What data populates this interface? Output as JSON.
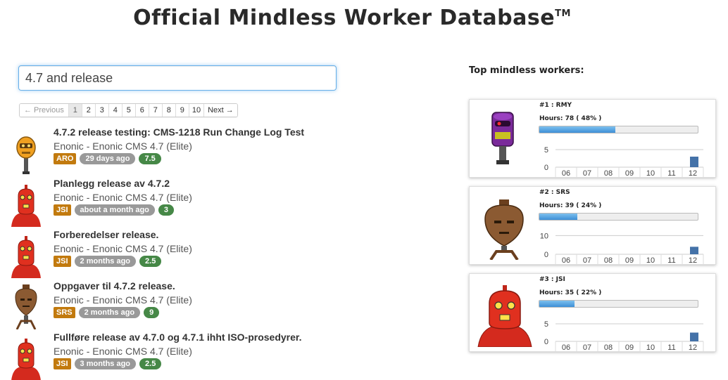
{
  "page": {
    "title": "Official Mindless Worker Database",
    "title_mark": "TM"
  },
  "search": {
    "value": "4.7 and release"
  },
  "pagination": {
    "previous": "← Previous",
    "next": "Next →",
    "pages": [
      "1",
      "2",
      "3",
      "4",
      "5",
      "6",
      "7",
      "8",
      "9",
      "10"
    ],
    "active_page": "1"
  },
  "results": [
    {
      "title": "4.7.2 release testing: CMS-1218 Run Change Log Test",
      "subtitle": "Enonic - Enonic CMS 4.7 (Elite)",
      "user": "ARO",
      "time": "29 days ago",
      "hours": "7.5",
      "avatar_icon": "orange-robot-icon"
    },
    {
      "title": "Planlegg release av 4.7.2",
      "subtitle": "Enonic - Enonic CMS 4.7 (Elite)",
      "user": "JSI",
      "time": "about a month ago",
      "hours": "3",
      "avatar_icon": "red-robot-icon"
    },
    {
      "title": "Forberedelser release.",
      "subtitle": "Enonic - Enonic CMS 4.7 (Elite)",
      "user": "JSI",
      "time": "2 months ago",
      "hours": "2.5",
      "avatar_icon": "red-robot-icon"
    },
    {
      "title": "Oppgaver til 4.7.2 release.",
      "subtitle": "Enonic - Enonic CMS 4.7 (Elite)",
      "user": "SRS",
      "time": "2 months ago",
      "hours": "9",
      "avatar_icon": "brown-robot-icon"
    },
    {
      "title": "Fullføre release av 4.7.0 og 4.7.1 ihht ISO-prosedyrer.",
      "subtitle": "Enonic - Enonic CMS 4.7 (Elite)",
      "user": "JSI",
      "time": "3 months ago",
      "hours": "2.5",
      "avatar_icon": "red-robot-icon"
    }
  ],
  "top_workers": {
    "heading": "Top mindless workers:",
    "workers": [
      {
        "rank_label": "#1 : RMY",
        "hours_label": "Hours: 78 ( 48% )",
        "percent": 48,
        "avatar_icon": "purple-robot-icon"
      },
      {
        "rank_label": "#2 : SRS",
        "hours_label": "Hours: 39 ( 24% )",
        "percent": 24,
        "avatar_icon": "brown-robot-icon"
      },
      {
        "rank_label": "#3 : JSI",
        "hours_label": "Hours: 35 ( 22% )",
        "percent": 22,
        "avatar_icon": "red-robot-icon"
      }
    ]
  },
  "chart_data": [
    {
      "type": "bar",
      "categories": [
        "06",
        "07",
        "08",
        "09",
        "10",
        "11",
        "12"
      ],
      "values": [
        0,
        0,
        0,
        0,
        0,
        0,
        3
      ],
      "yticks": [
        0,
        5
      ],
      "ylim": [
        0,
        8
      ],
      "color": "#4472a8"
    },
    {
      "type": "bar",
      "categories": [
        "06",
        "07",
        "08",
        "09",
        "10",
        "11",
        "12"
      ],
      "values": [
        0,
        0,
        0,
        0,
        0,
        0,
        4
      ],
      "yticks": [
        0,
        10
      ],
      "ylim": [
        0,
        15
      ],
      "color": "#4472a8"
    },
    {
      "type": "bar",
      "categories": [
        "06",
        "07",
        "08",
        "09",
        "10",
        "11",
        "12"
      ],
      "values": [
        0,
        0,
        0,
        0,
        0,
        0,
        2.5
      ],
      "yticks": [
        0,
        5
      ],
      "ylim": [
        0,
        8
      ],
      "color": "#4472a8"
    }
  ]
}
